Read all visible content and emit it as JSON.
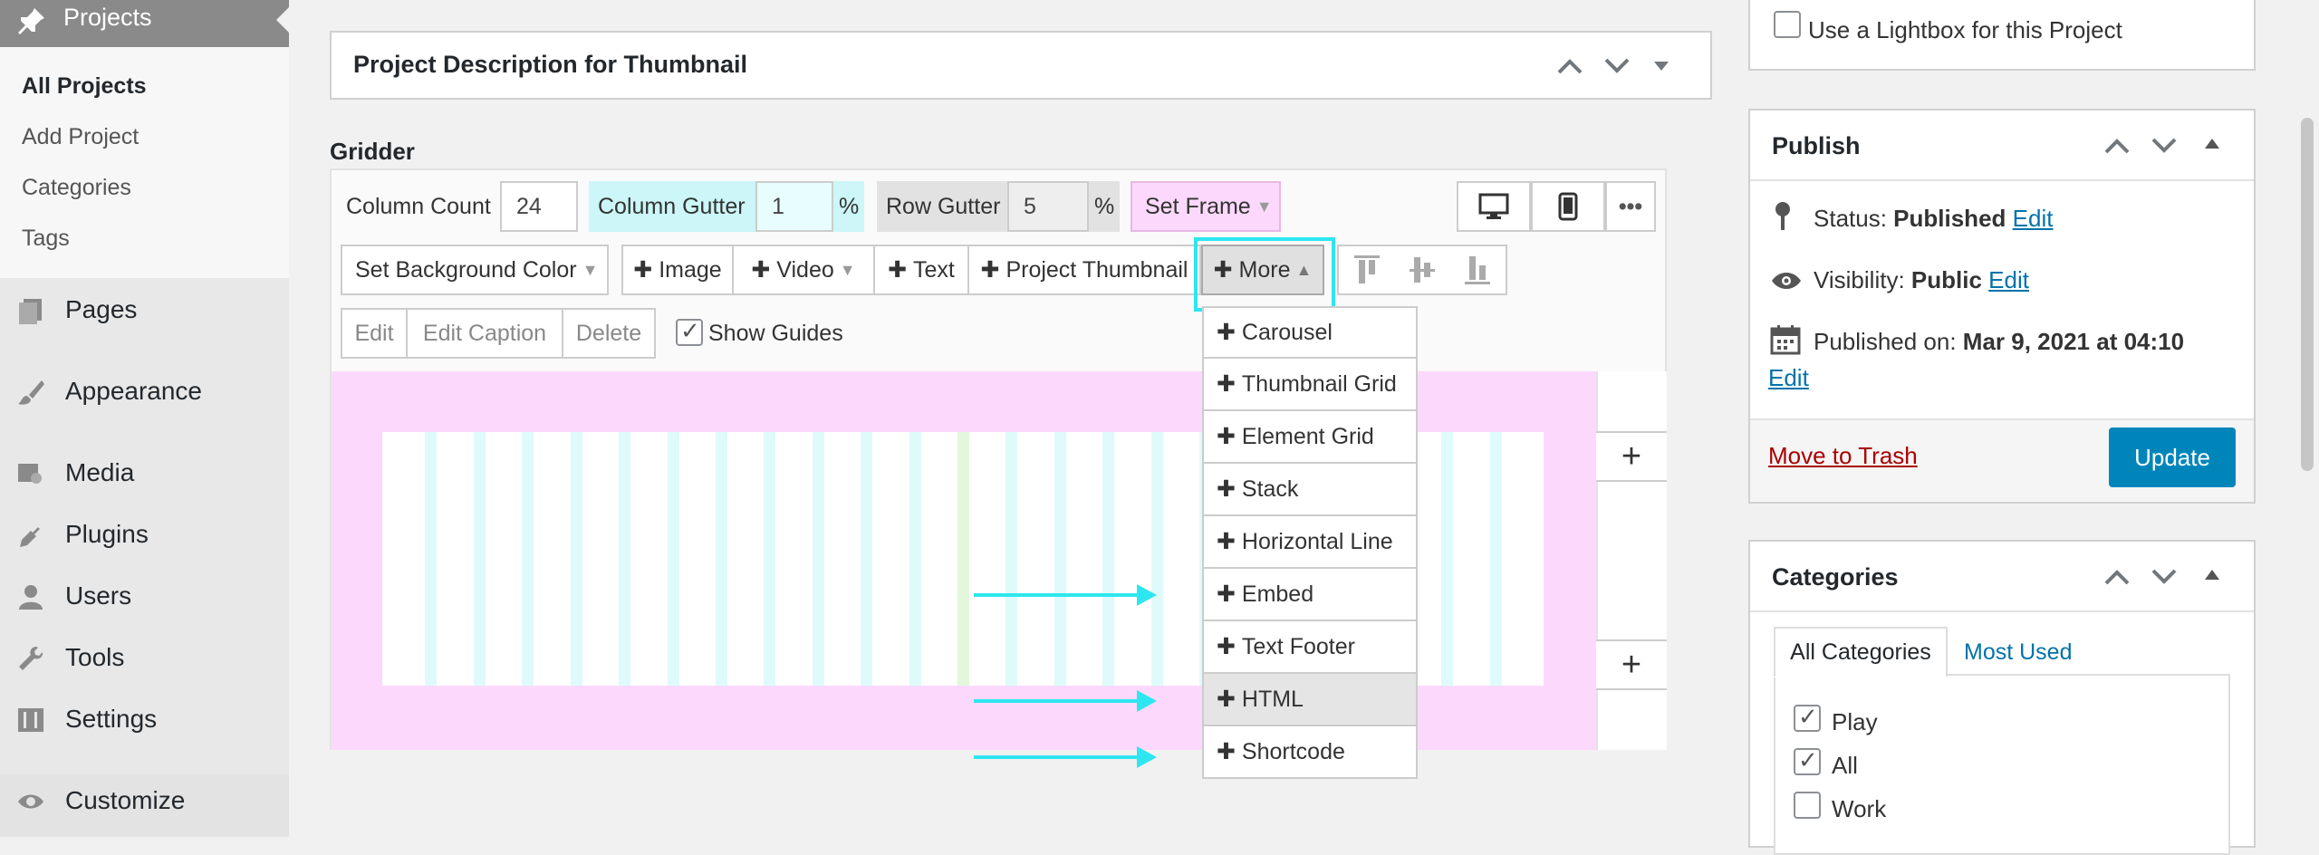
{
  "sidebar": {
    "header": "Projects",
    "sub": [
      "All Projects",
      "Add Project",
      "Categories",
      "Tags"
    ],
    "items": [
      "Pages",
      "Appearance",
      "Media",
      "Plugins",
      "Users",
      "Tools",
      "Settings",
      "Customize"
    ]
  },
  "desc_panel": {
    "title": "Project Description for Thumbnail"
  },
  "gridder": {
    "title": "Gridder",
    "column_count_label": "Column Count",
    "column_count": "24",
    "column_gutter_label": "Column Gutter",
    "column_gutter": "1",
    "pct": "%",
    "row_gutter_label": "Row Gutter",
    "row_gutter": "5",
    "set_frame": "Set Frame",
    "set_bg": "Set Background Color",
    "image": "Image",
    "video": "Video",
    "text": "Text",
    "project_thumbnail": "Project Thumbnail",
    "more": "More",
    "edit": "Edit",
    "edit_caption": "Edit Caption",
    "delete": "Delete",
    "show_guides": "Show Guides",
    "more_menu": [
      "Carousel",
      "Thumbnail Grid",
      "Element Grid",
      "Stack",
      "Horizontal Line",
      "Embed",
      "Text Footer",
      "HTML",
      "Shortcode"
    ],
    "plus": "+",
    "colors": {
      "frame": "#fcd9fc",
      "gutter_col": "#dffafa",
      "highlight": "#2ee6f0"
    }
  },
  "lightbox": {
    "label": "Use a Lightbox for this Project"
  },
  "publish": {
    "title": "Publish",
    "status_label": "Status:",
    "status": "Published",
    "edit": "Edit",
    "visibility_label": "Visibility:",
    "visibility": "Public",
    "published_label": "Published on:",
    "published": "Mar 9, 2021 at 04:10",
    "trash": "Move to Trash",
    "update": "Update"
  },
  "categories": {
    "title": "Categories",
    "tab_all": "All Categories",
    "tab_used": "Most Used",
    "items": [
      {
        "label": "Play",
        "checked": true
      },
      {
        "label": "All",
        "checked": true
      },
      {
        "label": "Work",
        "checked": false
      }
    ]
  }
}
